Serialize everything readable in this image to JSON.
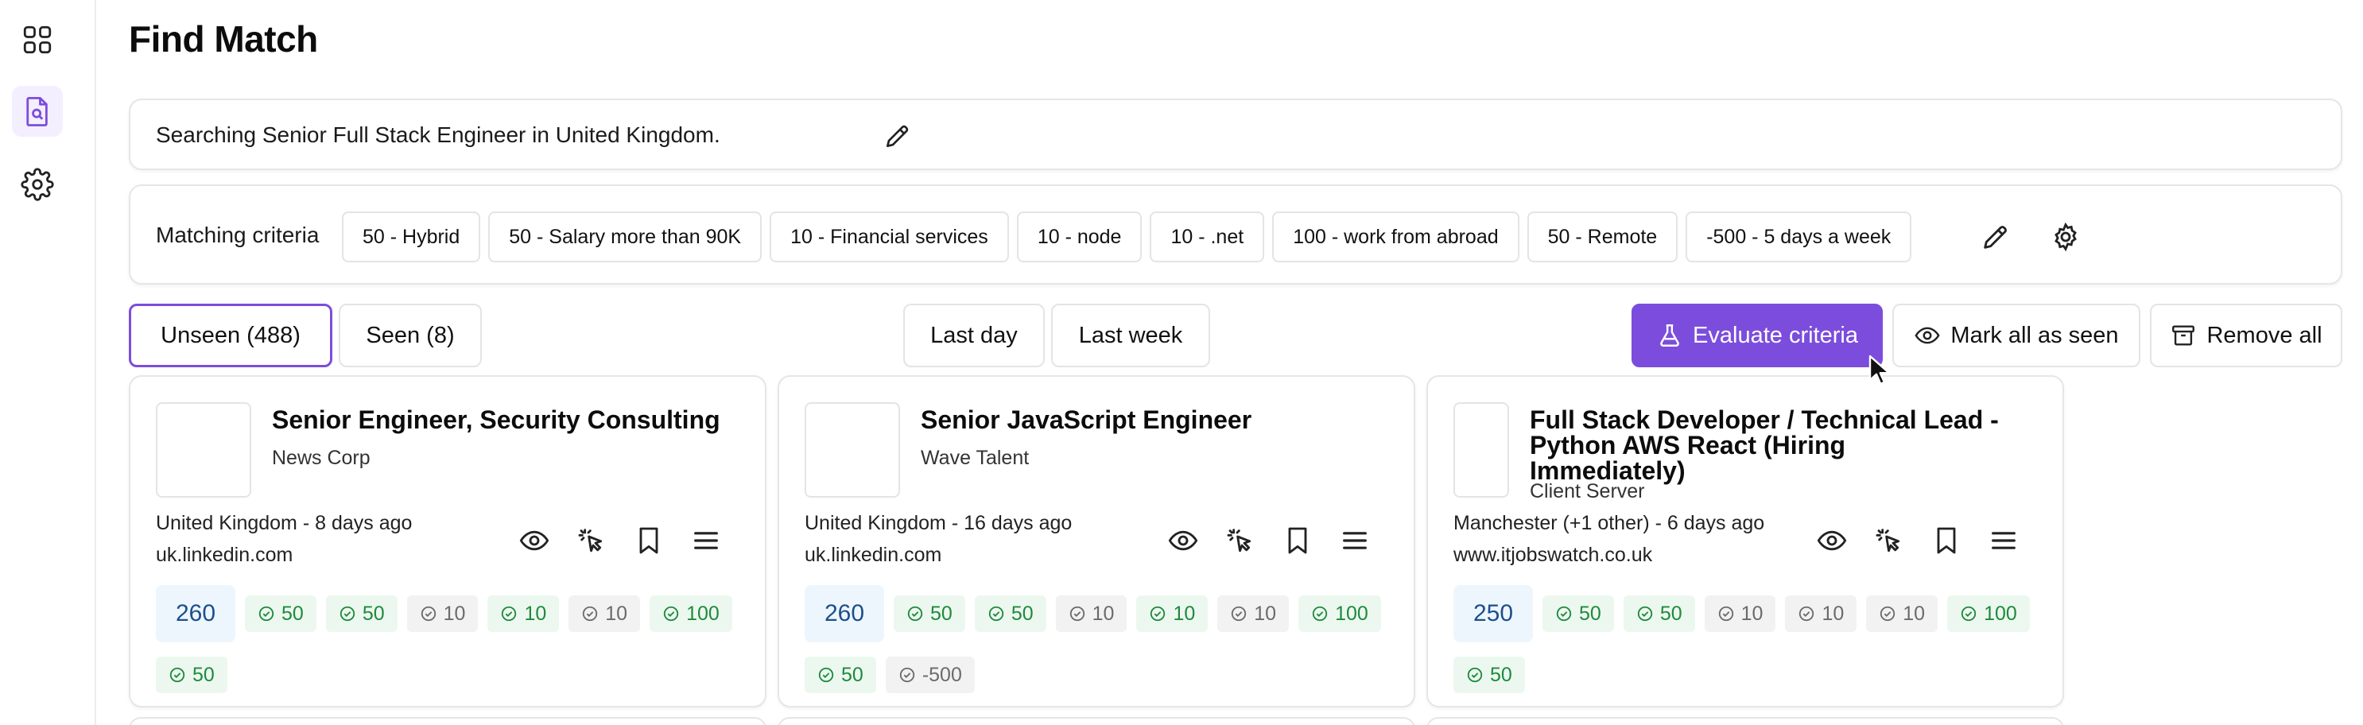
{
  "page": {
    "title": "Find Match"
  },
  "sidebar": {
    "items": [
      {
        "name": "apps",
        "icon": "grid-icon"
      },
      {
        "name": "find-match",
        "icon": "document-search-icon",
        "active": true
      },
      {
        "name": "settings",
        "icon": "gear-icon"
      }
    ]
  },
  "search": {
    "text": "Searching Senior Full Stack Engineer in United Kingdom."
  },
  "criteria": {
    "label": "Matching criteria",
    "items": [
      "50 - Hybrid",
      "50 - Salary more than 90K",
      "10 - Financial services",
      "10 - node",
      "10 - .net",
      "100 - work from abroad",
      "50 - Remote",
      "-500 - 5 days a week"
    ]
  },
  "tabs": {
    "unseen": "Unseen (488)",
    "seen": "Seen (8)"
  },
  "filters": {
    "last_day": "Last day",
    "last_week": "Last week"
  },
  "actions": {
    "evaluate": "Evaluate criteria",
    "mark_seen": "Mark all as seen",
    "remove_all": "Remove all"
  },
  "colors": {
    "accent": "#7c4ddc",
    "match": "#1e8a3c",
    "nomatch": "#6b6b6b",
    "score_bg": "#eef6fd"
  },
  "jobs": [
    {
      "title": "Senior Engineer, Security Consulting",
      "company": "News Corp",
      "location": "United Kingdom - 8 days ago",
      "site": "uk.linkedin.com",
      "score": "260",
      "pills": [
        {
          "v": "50",
          "ok": true
        },
        {
          "v": "50",
          "ok": true
        },
        {
          "v": "10",
          "ok": false
        },
        {
          "v": "10",
          "ok": true
        },
        {
          "v": "10",
          "ok": false
        },
        {
          "v": "100",
          "ok": true
        },
        {
          "v": "50",
          "ok": true
        }
      ]
    },
    {
      "title": "Senior JavaScript Engineer",
      "company": "Wave Talent",
      "location": "United Kingdom - 16 days ago",
      "site": "uk.linkedin.com",
      "score": "260",
      "pills": [
        {
          "v": "50",
          "ok": true
        },
        {
          "v": "50",
          "ok": true
        },
        {
          "v": "10",
          "ok": false
        },
        {
          "v": "10",
          "ok": true
        },
        {
          "v": "10",
          "ok": false
        },
        {
          "v": "100",
          "ok": true
        },
        {
          "v": "50",
          "ok": true
        },
        {
          "v": "-500",
          "ok": false
        }
      ]
    },
    {
      "title": "Full Stack Developer / Technical Lead - Python AWS React (Hiring Immediately)",
      "company": "Client Server",
      "location": "Manchester (+1 other) - 6 days ago",
      "site": "www.itjobswatch.co.uk",
      "score": "250",
      "pills": [
        {
          "v": "50",
          "ok": true
        },
        {
          "v": "50",
          "ok": true
        },
        {
          "v": "10",
          "ok": false
        },
        {
          "v": "10",
          "ok": false
        },
        {
          "v": "10",
          "ok": false
        },
        {
          "v": "100",
          "ok": true
        },
        {
          "v": "50",
          "ok": true
        }
      ]
    }
  ]
}
